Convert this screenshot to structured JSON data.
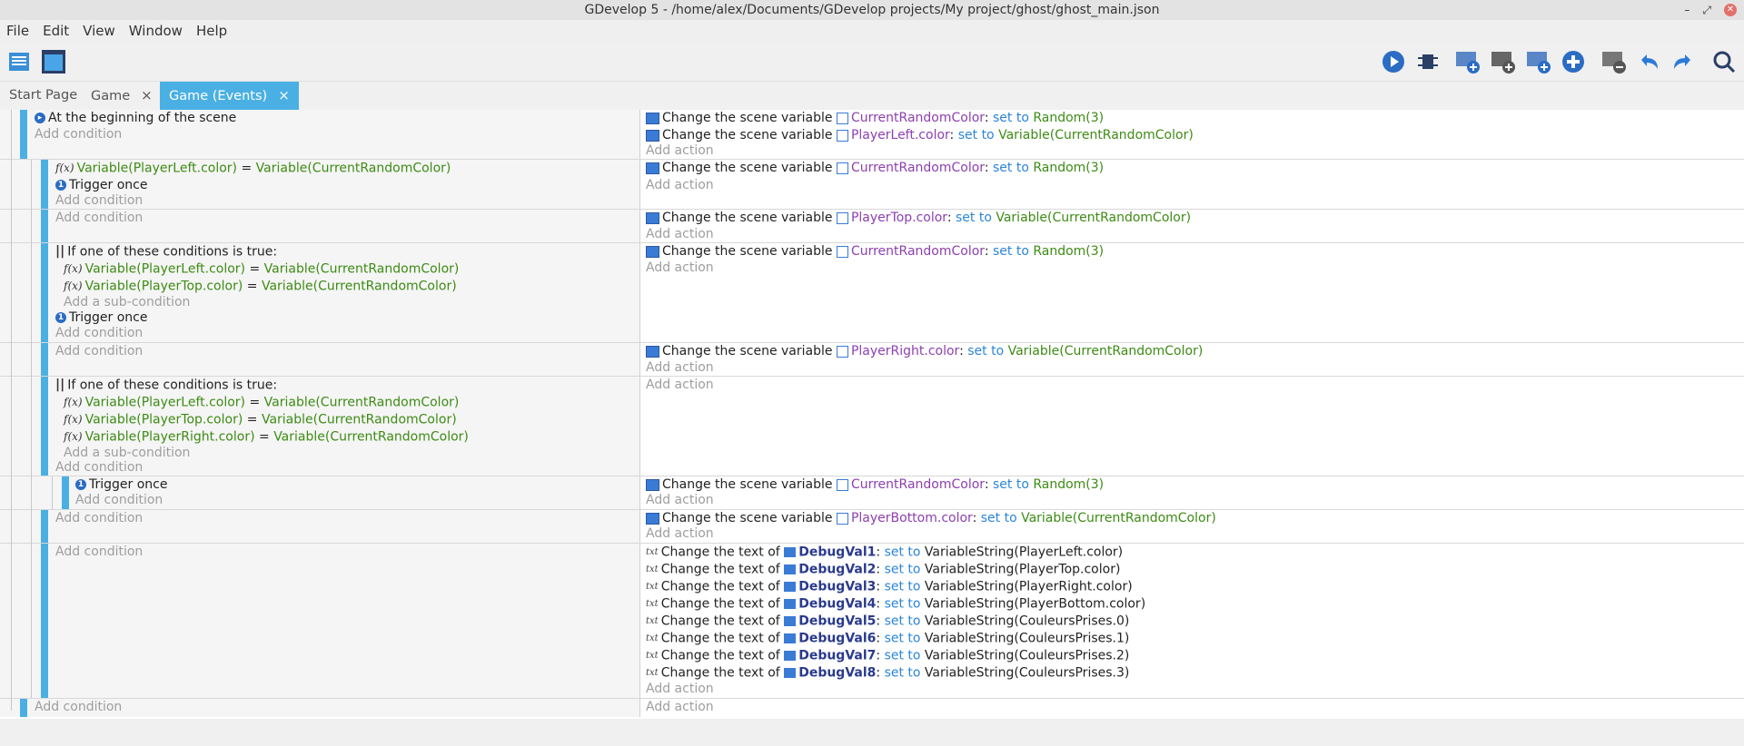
{
  "window": {
    "title": "GDevelop 5 - /home/alex/Documents/GDevelop projects/My project/ghost/ghost_main.json"
  },
  "menu": [
    "File",
    "Edit",
    "View",
    "Window",
    "Help"
  ],
  "tabs": [
    {
      "label": "Start Page"
    },
    {
      "label": "Game",
      "close": "×"
    },
    {
      "label": "Game (Events)",
      "close": "×"
    }
  ],
  "toolbar_icons": [
    "project-manager-icon",
    "scene-editor-icon",
    "preview-icon",
    "debugger-icon",
    "add-event-icon",
    "add-subevent-icon",
    "add-comment-icon",
    "add-instruction-icon",
    "delete-event-icon",
    "undo-icon",
    "redo-icon",
    "search-icon"
  ],
  "labels": {
    "add_condition": "Add condition",
    "add_action": "Add action",
    "add_subcondition": "Add a sub-condition",
    "change_var": "Change the scene variable",
    "change_text": "Change the text of",
    "set_to": "set to",
    "or_title": "If one of these conditions is true:",
    "trigger_once": "Trigger once",
    "begin_scene": "At the beginning of the scene",
    "eq": "="
  },
  "events": [
    {
      "actions": [
        {
          "var": "CurrentRandomColor",
          "value": "Random(3)"
        },
        {
          "var": "PlayerLeft.color",
          "value": "Variable(CurrentRandomColor)"
        }
      ]
    },
    {
      "conditions": [
        {
          "left": "Variable(PlayerLeft.color)",
          "right": "Variable(CurrentRandomColor)"
        }
      ],
      "actions": [
        {
          "var": "CurrentRandomColor",
          "value": "Random(3)"
        }
      ]
    },
    {
      "actions": [
        {
          "var": "PlayerTop.color",
          "value": "Variable(CurrentRandomColor)"
        }
      ]
    },
    {
      "or_conditions": [
        {
          "left": "Variable(PlayerLeft.color)",
          "right": "Variable(CurrentRandomColor)"
        },
        {
          "left": "Variable(PlayerTop.color)",
          "right": "Variable(CurrentRandomColor)"
        }
      ],
      "actions": [
        {
          "var": "CurrentRandomColor",
          "value": "Random(3)"
        }
      ]
    },
    {
      "actions": [
        {
          "var": "PlayerRight.color",
          "value": "Variable(CurrentRandomColor)"
        }
      ]
    },
    {
      "or_conditions": [
        {
          "left": "Variable(PlayerLeft.color)",
          "right": "Variable(CurrentRandomColor)"
        },
        {
          "left": "Variable(PlayerTop.color)",
          "right": "Variable(CurrentRandomColor)"
        },
        {
          "left": "Variable(PlayerRight.color)",
          "right": "Variable(CurrentRandomColor)"
        }
      ]
    },
    {
      "actions": [
        {
          "var": "CurrentRandomColor",
          "value": "Random(3)"
        }
      ]
    },
    {
      "actions": [
        {
          "var": "PlayerBottom.color",
          "value": "Variable(CurrentRandomColor)"
        }
      ]
    },
    {
      "text_actions": [
        {
          "obj": "DebugVal1",
          "value": "VariableString(PlayerLeft.color)"
        },
        {
          "obj": "DebugVal2",
          "value": "VariableString(PlayerTop.color)"
        },
        {
          "obj": "DebugVal3",
          "value": "VariableString(PlayerRight.color)"
        },
        {
          "obj": "DebugVal4",
          "value": "VariableString(PlayerBottom.color)"
        },
        {
          "obj": "DebugVal5",
          "value": "VariableString(CouleursPrises.0)"
        },
        {
          "obj": "DebugVal6",
          "value": "VariableString(CouleursPrises.1)"
        },
        {
          "obj": "DebugVal7",
          "value": "VariableString(CouleursPrises.2)"
        },
        {
          "obj": "DebugVal8",
          "value": "VariableString(CouleursPrises.3)"
        }
      ]
    }
  ]
}
